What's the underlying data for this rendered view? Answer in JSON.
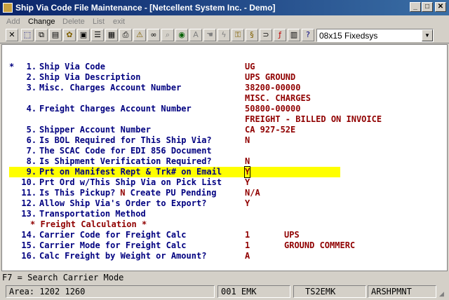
{
  "window": {
    "title": "Ship Via Code File Maintenance - [Netcellent System Inc. - Demo]",
    "minimize": "_",
    "maximize": "□",
    "close": "✕"
  },
  "menu": [
    {
      "label": "Add",
      "enabled": false
    },
    {
      "label": "Change",
      "enabled": true
    },
    {
      "label": "Delete",
      "enabled": false
    },
    {
      "label": "List",
      "enabled": false
    },
    {
      "label": "exit",
      "enabled": false
    }
  ],
  "toolbar": {
    "font_selected": "08x15 Fixedsys"
  },
  "form": {
    "rows": [
      {
        "marker": "*",
        "num": "1.",
        "label": "Ship Via Code",
        "value": "UG"
      },
      {
        "marker": "",
        "num": "2.",
        "label": "Ship Via Description",
        "value": "UPS GROUND"
      },
      {
        "marker": "",
        "num": "3.",
        "label": "Misc. Charges Account Number",
        "value": "38200-00000"
      },
      {
        "marker": "",
        "num": "",
        "label": "",
        "value": "MISC. CHARGES"
      },
      {
        "marker": "",
        "num": "4.",
        "label": "Freight Charges Account Number",
        "value": "50800-00000"
      },
      {
        "marker": "",
        "num": "",
        "label": "",
        "value": "FREIGHT - BILLED ON INVOICE"
      },
      {
        "marker": "",
        "num": "5.",
        "label": "Shipper Account Number",
        "value": "CA 927-52E"
      },
      {
        "marker": "",
        "num": "6.",
        "label": "Is BOL Required for This Ship Via?",
        "value": "N"
      },
      {
        "marker": "",
        "num": "7.",
        "label": "The SCAC Code for EDI 856 Document",
        "value": ""
      },
      {
        "marker": "",
        "num": "8.",
        "label": "Is Shipment Verification Required?",
        "value": "N"
      },
      {
        "marker": "",
        "num": "9.",
        "label": "Prt on Manifest Rept & Trk# on Email",
        "value": "Y"
      },
      {
        "marker": "",
        "num": "10.",
        "label": "Prt Ord w/This Ship Via on Pick List",
        "value": "Y"
      },
      {
        "marker": "",
        "num": "11.",
        "label": "Is This Pickup?",
        "value": "N/A",
        "inline_value": "N",
        "inline_label": "Create PU Pending"
      },
      {
        "marker": "",
        "num": "12.",
        "label": "Allow Ship Via's Order to Export?",
        "value": "Y"
      },
      {
        "marker": "",
        "num": "13.",
        "label": "Transportation Method",
        "value": ""
      },
      {
        "marker": "",
        "num": "",
        "label": "",
        "value": "",
        "section": "* Freight Calculation *"
      },
      {
        "marker": "",
        "num": "14.",
        "label": "Carrier Code for Freight Calc",
        "value": "1",
        "extra": "UPS"
      },
      {
        "marker": "",
        "num": "15.",
        "label": "Carrier Mode for Freight Calc",
        "value": "1",
        "extra": "GROUND COMMERC"
      },
      {
        "marker": "",
        "num": "16.",
        "label": "Calc Freight by Weight or Amount?",
        "value": "A"
      }
    ]
  },
  "help_line": "F7 = Search Carrier Mode",
  "status": {
    "area": "Area: 1202 1260",
    "user": "001 EMK",
    "terminal": "TS2EMK",
    "program": "ARSHPMNT"
  }
}
